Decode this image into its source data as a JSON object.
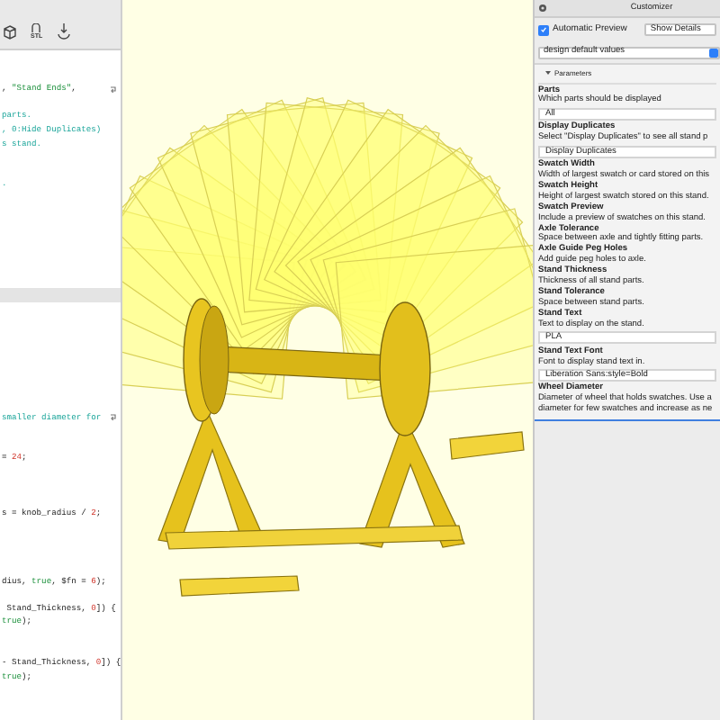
{
  "editor": {
    "toolbar": [
      {
        "kind": "cube"
      },
      {
        "kind": "stl",
        "label": "STL"
      },
      {
        "kind": "download"
      }
    ],
    "lines": [
      {
        "kind": "code",
        "wrapped": true,
        "tokens": [
          {
            "text": ", ",
            "kind": "plain"
          },
          {
            "text": "\"Stand Ends\"",
            "kind": "string"
          },
          {
            "text": ",",
            "kind": "plain"
          }
        ]
      },
      {
        "kind": "blank"
      },
      {
        "kind": "code",
        "tokens": [
          {
            "text": "parts.",
            "kind": "comment"
          }
        ]
      },
      {
        "kind": "code",
        "tokens": [
          {
            "text": ", 0:Hide Duplicates)",
            "kind": "comment"
          }
        ]
      },
      {
        "kind": "code",
        "tokens": [
          {
            "text": "s stand.",
            "kind": "comment"
          }
        ]
      },
      {
        "kind": "blank"
      },
      {
        "kind": "blank"
      },
      {
        "kind": "code",
        "tokens": [
          {
            "text": ".",
            "kind": "comment"
          }
        ]
      },
      {
        "kind": "blank"
      },
      {
        "kind": "blank"
      },
      {
        "kind": "blank"
      },
      {
        "kind": "blank"
      },
      {
        "kind": "blank"
      },
      {
        "kind": "blank"
      },
      {
        "kind": "blank"
      },
      {
        "kind": "blank",
        "current": true
      },
      {
        "kind": "blank"
      },
      {
        "kind": "blank"
      },
      {
        "kind": "blank"
      },
      {
        "kind": "blank"
      },
      {
        "kind": "blank"
      },
      {
        "kind": "blank"
      },
      {
        "kind": "blank"
      },
      {
        "kind": "blank"
      },
      {
        "kind": "code",
        "wrapped": true,
        "tokens": [
          {
            "text": "smaller diameter for",
            "kind": "comment"
          }
        ]
      },
      {
        "kind": "blank"
      },
      {
        "kind": "blank"
      },
      {
        "kind": "code",
        "tokens": [
          {
            "text": "= ",
            "kind": "plain"
          },
          {
            "text": "24",
            "kind": "number"
          },
          {
            "text": ";",
            "kind": "plain"
          }
        ]
      },
      {
        "kind": "blank"
      },
      {
        "kind": "blank"
      },
      {
        "kind": "blank"
      },
      {
        "kind": "code",
        "tokens": [
          {
            "text": "s = knob_radius / ",
            "kind": "plain"
          },
          {
            "text": "2",
            "kind": "number"
          },
          {
            "text": ";",
            "kind": "plain"
          }
        ]
      },
      {
        "kind": "blank"
      },
      {
        "kind": "blank"
      },
      {
        "kind": "blank"
      },
      {
        "kind": "blank"
      },
      {
        "kind": "code",
        "tokens": [
          {
            "text": "dius, ",
            "kind": "plain"
          },
          {
            "text": "true",
            "kind": "keyword"
          },
          {
            "text": ", $fn = ",
            "kind": "plain"
          },
          {
            "text": "6",
            "kind": "number"
          },
          {
            "text": ");",
            "kind": "plain"
          }
        ]
      },
      {
        "kind": "blank"
      },
      {
        "kind": "code",
        "tokens": [
          {
            "text": " Stand_Thickness, ",
            "kind": "plain"
          },
          {
            "text": "0",
            "kind": "number"
          },
          {
            "text": "]) {",
            "kind": "plain"
          }
        ]
      },
      {
        "kind": "code",
        "tokens": [
          {
            "text": "true",
            "kind": "keyword"
          },
          {
            "text": ");",
            "kind": "plain"
          }
        ]
      },
      {
        "kind": "blank"
      },
      {
        "kind": "blank"
      },
      {
        "kind": "code",
        "tokens": [
          {
            "text": "- Stand_Thickness, ",
            "kind": "plain"
          },
          {
            "text": "0",
            "kind": "number"
          },
          {
            "text": "]) {",
            "kind": "plain"
          }
        ]
      },
      {
        "kind": "code",
        "tokens": [
          {
            "text": "true",
            "kind": "keyword"
          },
          {
            "text": ");",
            "kind": "plain"
          }
        ]
      }
    ]
  },
  "customizer": {
    "title": "Customizer",
    "automatic_preview": {
      "label": "Automatic Preview",
      "checked": true
    },
    "details_select": "Show Details",
    "preset_select": "design default values",
    "section": {
      "label": "Parameters",
      "expanded": true,
      "params": [
        {
          "name": "Parts",
          "description": "Which parts should be displayed",
          "kind": "select",
          "value": "All"
        },
        {
          "name": "Display Duplicates",
          "description": "Select \"Display Duplicates\" to see all stand p",
          "kind": "select",
          "value": "Display Duplicates"
        },
        {
          "name": "Swatch Width",
          "description": "Width of largest swatch or card stored on this",
          "kind": "info"
        },
        {
          "name": "Swatch Height",
          "description": "Height of largest swatch stored on this stand.",
          "kind": "info"
        },
        {
          "name": "Swatch Preview",
          "description": "Include a preview of swatches on this stand.",
          "kind": "info"
        },
        {
          "name": "Axle Tolerance",
          "description": "Space between axle and tightly fitting parts.",
          "kind": "info"
        },
        {
          "name": "Axle Guide Peg Holes",
          "description": "Add guide peg holes to axle.",
          "kind": "info"
        },
        {
          "name": "Stand Thickness",
          "description": "Thickness of all stand parts.",
          "kind": "info"
        },
        {
          "name": "Stand Tolerance",
          "description": "Space between stand parts.",
          "kind": "info"
        },
        {
          "name": "Stand Text",
          "description": "Text to display on the stand.",
          "kind": "text",
          "value": "PLA"
        },
        {
          "name": "Stand Text Font",
          "description": "Font to display stand text in.",
          "kind": "text",
          "value": "Liberation Sans:style=Bold"
        },
        {
          "name": "Wheel Diameter",
          "description": "Diameter of wheel that holds swatches. Use a",
          "description_2": "diameter for few swatches and increase as ne",
          "kind": "info"
        }
      ]
    }
  }
}
